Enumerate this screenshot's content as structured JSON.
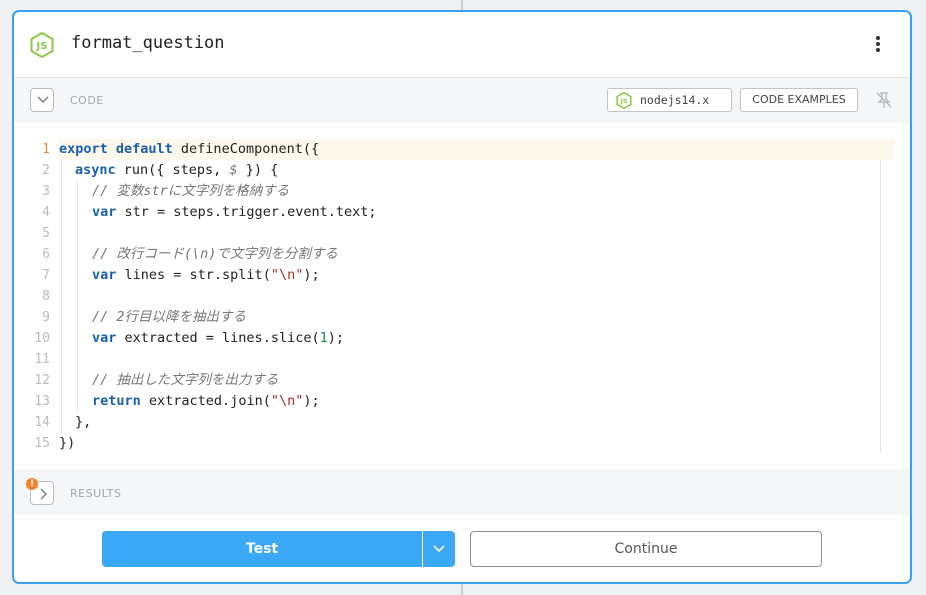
{
  "header": {
    "title": "format_question",
    "logo_icon": "nodejs-icon",
    "menu_icon": "kebab-menu-icon"
  },
  "code_section": {
    "label": "CODE",
    "runtime": "nodejs14.x",
    "examples_label": "CODE EXAMPLES",
    "pin_icon": "pin-off-icon"
  },
  "editor": {
    "active_line": 1,
    "lines": [
      {
        "num": "1",
        "indent": 0,
        "tokens": [
          {
            "t": "export default",
            "c": "kw"
          },
          {
            "t": " defineComponent({",
            "c": ""
          }
        ]
      },
      {
        "num": "2",
        "indent": 1,
        "tokens": [
          {
            "t": "async",
            "c": "kw"
          },
          {
            "t": " run({ steps, ",
            "c": ""
          },
          {
            "t": "$",
            "c": "cm"
          },
          {
            "t": " }) {",
            "c": ""
          }
        ]
      },
      {
        "num": "3",
        "indent": 2,
        "tokens": [
          {
            "t": "// 変数strに文字列を格納する",
            "c": "cm"
          }
        ]
      },
      {
        "num": "4",
        "indent": 2,
        "tokens": [
          {
            "t": "var",
            "c": "kw"
          },
          {
            "t": " str = steps.trigger.event.text;",
            "c": ""
          }
        ]
      },
      {
        "num": "5",
        "indent": 2,
        "tokens": []
      },
      {
        "num": "6",
        "indent": 2,
        "tokens": [
          {
            "t": "// 改行コード(\\n)で文字列を分割する",
            "c": "cm"
          }
        ]
      },
      {
        "num": "7",
        "indent": 2,
        "tokens": [
          {
            "t": "var",
            "c": "kw"
          },
          {
            "t": " lines = str.split(",
            "c": ""
          },
          {
            "t": "\"\\n\"",
            "c": "str"
          },
          {
            "t": ");",
            "c": ""
          }
        ]
      },
      {
        "num": "8",
        "indent": 2,
        "tokens": []
      },
      {
        "num": "9",
        "indent": 2,
        "tokens": [
          {
            "t": "// 2行目以降を抽出する",
            "c": "cm"
          }
        ]
      },
      {
        "num": "10",
        "indent": 2,
        "tokens": [
          {
            "t": "var",
            "c": "kw"
          },
          {
            "t": " extracted = lines.slice(",
            "c": ""
          },
          {
            "t": "1",
            "c": "num"
          },
          {
            "t": ");",
            "c": ""
          }
        ]
      },
      {
        "num": "11",
        "indent": 2,
        "tokens": []
      },
      {
        "num": "12",
        "indent": 2,
        "tokens": [
          {
            "t": "// 抽出した文字列を出力する",
            "c": "cm"
          }
        ]
      },
      {
        "num": "13",
        "indent": 2,
        "tokens": [
          {
            "t": "return",
            "c": "kw"
          },
          {
            "t": " extracted.join(",
            "c": ""
          },
          {
            "t": "\"\\n\"",
            "c": "str"
          },
          {
            "t": ");",
            "c": ""
          }
        ]
      },
      {
        "num": "14",
        "indent": 1,
        "tokens": [
          {
            "t": "},",
            "c": ""
          }
        ]
      },
      {
        "num": "15",
        "indent": 0,
        "tokens": [
          {
            "t": "})",
            "c": ""
          }
        ]
      }
    ]
  },
  "results_section": {
    "label": "RESULTS",
    "warning_badge": "!"
  },
  "footer": {
    "test_label": "Test",
    "continue_label": "Continue"
  },
  "colors": {
    "accent": "#3aa8f4",
    "warning": "#f2832b",
    "node_green": "#8cc84b"
  }
}
